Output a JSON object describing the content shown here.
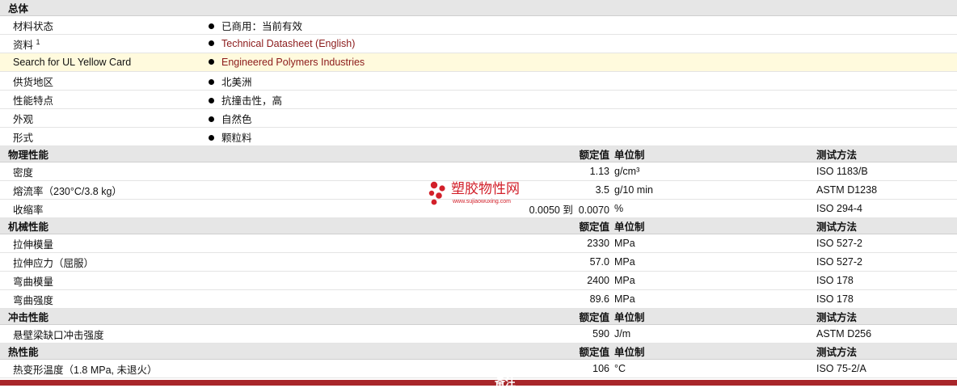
{
  "general": {
    "title": "总体",
    "rows": [
      {
        "label": "材料状态",
        "value": "已商用：当前有效"
      },
      {
        "label": "资料",
        "sup": "1",
        "value": "Technical Datasheet (English)"
      },
      {
        "label": "Search for UL Yellow Card",
        "value": "Engineered Polymers Industries"
      },
      {
        "label": "供货地区",
        "value": "北美洲"
      },
      {
        "label": "性能特点",
        "value": "抗撞击性，高"
      },
      {
        "label": "外观",
        "value": "自然色"
      },
      {
        "label": "形式",
        "value": "颗粒料"
      }
    ]
  },
  "columns": {
    "value": "额定值",
    "unit": "单位制",
    "method": "测试方法"
  },
  "physical": {
    "title": "物理性能",
    "rows": [
      {
        "label": "密度",
        "value": "1.13",
        "unit": "g/cm³",
        "method": "ISO 1183/B"
      },
      {
        "label": "熔流率（230°C/3.8 kg）",
        "value": "3.5",
        "unit": "g/10 min",
        "method": "ASTM D1238"
      },
      {
        "label": "收缩率",
        "value": "0.0050 到  0.0070",
        "unit": "%",
        "method": "ISO 294-4"
      }
    ]
  },
  "mechanical": {
    "title": "机械性能",
    "rows": [
      {
        "label": "拉伸模量",
        "value": "2330",
        "unit": "MPa",
        "method": "ISO 527-2"
      },
      {
        "label": "拉伸应力（屈服）",
        "value": "57.0",
        "unit": "MPa",
        "method": "ISO 527-2"
      },
      {
        "label": "弯曲模量",
        "value": "2400",
        "unit": "MPa",
        "method": "ISO 178"
      },
      {
        "label": "弯曲强度",
        "value": "89.6",
        "unit": "MPa",
        "method": "ISO 178"
      }
    ]
  },
  "impact": {
    "title": "冲击性能",
    "rows": [
      {
        "label": "悬壁梁缺口冲击强度",
        "value": "590",
        "unit": "J/m",
        "method": "ASTM D256"
      }
    ]
  },
  "thermal": {
    "title": "热性能",
    "rows": [
      {
        "label": "热变形温度（1.8 MPa, 未退火）",
        "value": "106",
        "unit": "°C",
        "method": "ISO 75-2/A"
      }
    ]
  },
  "footer": {
    "label": "备注"
  },
  "watermark": {
    "title": "塑胶物性网",
    "url": "www.sujiaowuxing.com",
    "color": "#d2202a"
  },
  "colors": {
    "section_bg": "#e6e6e6",
    "highlight_row": "#fffadd",
    "link": "#8b1a1a",
    "footer_bar": "#a8262a"
  }
}
